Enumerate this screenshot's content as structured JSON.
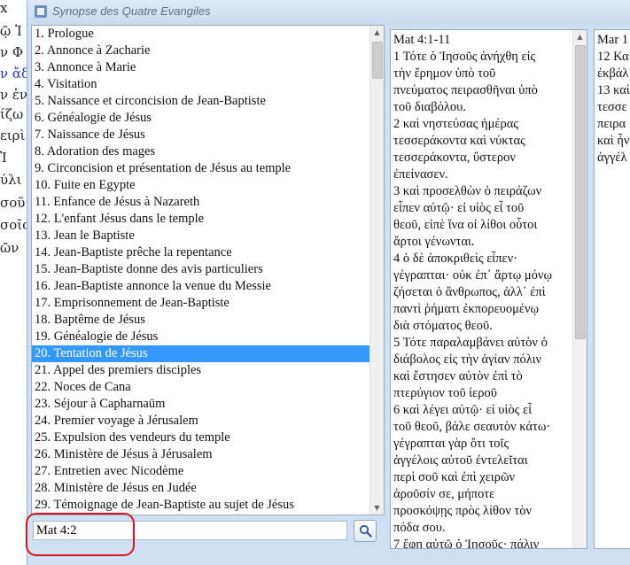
{
  "background_doc": {
    "lines": [
      {
        "text": "x",
        "blue": false
      },
      {
        "text": "ῷ Ἰ",
        "blue": false
      },
      {
        "text": "ν Φ",
        "blue": false
      },
      {
        "text": "ν ἄδ",
        "blue": true
      },
      {
        "text": "ν ἐν",
        "blue": false
      },
      {
        "text": "ίζω",
        "blue": false
      },
      {
        "text": "ειρὶ",
        "blue": false
      },
      {
        "text": "Ἰ",
        "blue": false
      },
      {
        "text": "ύλι",
        "blue": false
      },
      {
        "text": "σοῦ",
        "blue": false
      },
      {
        "text": "σοῖς",
        "blue": false
      },
      {
        "text": "ῶν",
        "blue": false
      }
    ]
  },
  "window": {
    "title": "Synopse des Quatre Evangiles"
  },
  "list": {
    "selected_index": 19,
    "items": [
      "1. Prologue",
      "2. Annonce à Zacharie",
      "3. Annonce à Marie",
      "4. Visitation",
      "5. Naissance et circoncision de Jean-Baptiste",
      "6. Généalogie de Jésus",
      "7. Naissance de Jésus",
      "8. Adoration des mages",
      "9. Circoncision et présentation de Jésus au temple",
      "10. Fuite en Egypte",
      "11. Enfance de Jésus à Nazareth",
      "12. L'enfant Jésus dans le temple",
      "13. Jean le Baptiste",
      "14. Jean-Baptiste prêche la repentance",
      "15. Jean-Baptiste donne des avis particuliers",
      "16. Jean-Baptiste annonce la venue du Messie",
      "17. Emprisonnement de Jean-Baptiste",
      "18. Baptême de Jésus",
      "19. Généalogie de Jésus",
      "20. Tentation de Jésus",
      "21. Appel des premiers disciples",
      "22. Noces de Cana",
      "23. Séjour à Capharnaüm",
      "24. Premier voyage à Jérusalem",
      "25. Expulsion des vendeurs du temple",
      "26. Ministère de Jésus à Jérusalem",
      "27. Entretien avec Nicodème",
      "28. Ministère de Jésus en Judée",
      "29. Témoignage de Jean-Baptiste au sujet de Jésus"
    ]
  },
  "search": {
    "value": "Mat 4:2",
    "button_icon": "search-icon"
  },
  "text_panel_1": {
    "lines": [
      "Mat 4:1-11",
      "1 Τότε ὁ Ἰησοῦς ἀνήχθη εἰς",
      "τὴν ἔρημον ὑπὸ τοῦ",
      "πνεύματος πειρασθῆναι ὑπὸ",
      "τοῦ διαβόλου.",
      "2 καὶ νηστεύσας ἡμέρας",
      "τεσσεράκοντα καὶ νύκτας",
      "τεσσεράκοντα, ὕστερον",
      "ἐπείνασεν.",
      "3 καὶ προσελθὼν ὁ πειράζων",
      "εἶπεν αὐτῷ· εἰ υἱὸς εἶ τοῦ",
      "θεοῦ, εἰπὲ ἵνα οἱ λίθοι οὗτοι",
      "ἄρτοι γένωνται.",
      "4 ὁ δὲ ἀποκριθεὶς εἶπεν·",
      "γέγραπται· οὐκ ἐπ᾽ ἄρτῳ μόνῳ",
      "ζήσεται ὁ ἄνθρωπος, ἀλλ᾽ ἐπὶ",
      "παντὶ ῥήματι ἐκπορευομένῳ",
      "διὰ στόματος θεοῦ.",
      "5 Τότε παραλαμβάνει αὐτὸν ὁ",
      "διάβολος εἰς τὴν ἁγίαν πόλιν",
      "καὶ ἔστησεν αὐτὸν ἐπὶ τὸ",
      "πτερύγιον τοῦ ἱεροῦ",
      "6 καὶ λέγει αὐτῷ· εἰ υἱὸς εἶ",
      "τοῦ θεοῦ, βάλε σεαυτὸν κάτω·",
      "γέγραπται γὰρ ὅτι τοῖς",
      "ἀγγέλοις αὐτοῦ ἐντελεῖται",
      "περὶ σοῦ καὶ ἐπὶ χειρῶν",
      "ἀροῦσίν σε, μήποτε",
      "προσκόψῃς πρὸς λίθον τὸν",
      "πόδα σου.",
      "7 ἔφη αὐτῷ ὁ Ἰησοῦς· πάλιν"
    ]
  },
  "text_panel_2": {
    "lines": [
      "Mar 1",
      "12 Κα",
      "ἐκβάλ",
      "13 καὶ",
      "τεσσε",
      "πειρα",
      "καὶ ἦν",
      "ἀγγέλ"
    ]
  },
  "colors": {
    "selection": "#3399ff",
    "highlight_ring": "#e0101c",
    "window_bg": "#cfe0f2"
  }
}
